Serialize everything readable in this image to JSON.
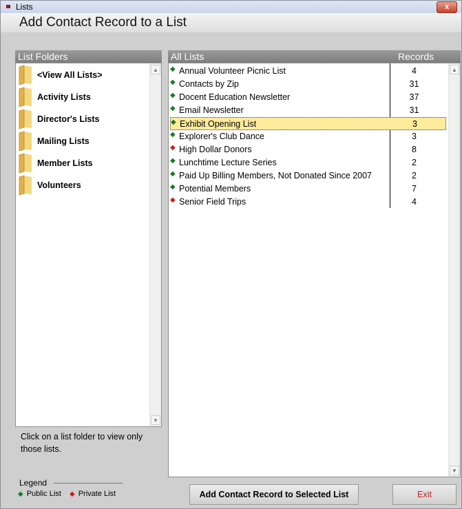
{
  "window": {
    "title": "Lists",
    "close_label": "x"
  },
  "heading": "Add Contact Record to a List",
  "folders": {
    "header": "List Folders",
    "items": [
      "<View All Lists>",
      "Activity Lists",
      "Director's Lists",
      "Mailing Lists",
      "Member Lists",
      "Volunteers"
    ]
  },
  "hint": "Click on a list folder to view only those lists.",
  "legend": {
    "title": "Legend",
    "public": "Public List",
    "private": "Private List",
    "public_color": "#1a7a2a",
    "private_color": "#c81e1e"
  },
  "lists": {
    "header_name": "All Lists",
    "header_records": "Records",
    "selected_index": 4,
    "rows": [
      {
        "name": "Annual Volunteer Picnic List",
        "records": "4",
        "type": "public"
      },
      {
        "name": "Contacts by Zip",
        "records": "31",
        "type": "public"
      },
      {
        "name": "Docent Education Newsletter",
        "records": "37",
        "type": "public"
      },
      {
        "name": "Email Newsletter",
        "records": "31",
        "type": "public"
      },
      {
        "name": "Exhibit Opening List",
        "records": "3",
        "type": "public"
      },
      {
        "name": "Explorer's Club Dance",
        "records": "3",
        "type": "public"
      },
      {
        "name": "High Dollar Donors",
        "records": "8",
        "type": "private"
      },
      {
        "name": "Lunchtime Lecture Series",
        "records": "2",
        "type": "public"
      },
      {
        "name": "Paid Up Billing Members, Not Donated Since 2007",
        "records": "2",
        "type": "public"
      },
      {
        "name": "Potential Members",
        "records": "7",
        "type": "public"
      },
      {
        "name": "Senior Field Trips",
        "records": "4",
        "type": "private"
      }
    ]
  },
  "buttons": {
    "add": "Add Contact Record to Selected List",
    "exit": "Exit",
    "exit_color": "#c0202a"
  }
}
